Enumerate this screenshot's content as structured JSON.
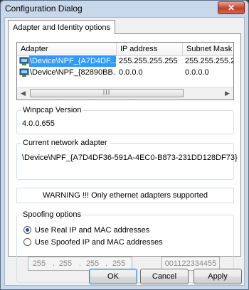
{
  "window": {
    "title": "Configuration Dialog",
    "close_symbol": "✕"
  },
  "tab": {
    "label": "Adapter and Identity options"
  },
  "adapter_list": {
    "columns": [
      "Adapter",
      "IP address",
      "Subnet Mask"
    ],
    "rows": [
      {
        "adapter": "\\Device\\NPF_{A7D4DF...",
        "ip": "255.255.255.255",
        "mask": "255.255.255.2",
        "selected": true
      },
      {
        "adapter": "\\Device\\NPF_{82890BB...",
        "ip": "0.0.0.0",
        "mask": "0.0.0.0",
        "selected": false
      }
    ],
    "scroll_left": "◀",
    "scroll_right": "▶",
    "thumb_grip": "III"
  },
  "winpcap": {
    "label": "Winpcap Version",
    "value": "4.0.0.655"
  },
  "current_adapter": {
    "label": "Current network adapter",
    "value": "\\Device\\NPF_{A7D4DF36-591A-4EC0-B873-231DD128DF73}"
  },
  "warning": "WARNING !!! Only ethernet adapters supported",
  "spoofing": {
    "label": "Spoofing options",
    "option_real": "Use Real IP and MAC addresses",
    "option_spoofed": "Use Spoofed IP and MAC addresses",
    "selected": "real",
    "ip_octets": [
      "255",
      "255",
      "255",
      "255"
    ],
    "ip_dot": ".",
    "mac": "001122334455"
  },
  "buttons": {
    "ok": "OK",
    "cancel": "Cancel",
    "apply": "Apply"
  },
  "colors": {
    "selection": "#3399ff",
    "frame": "#c8d8ea",
    "close": "#c0402c"
  }
}
